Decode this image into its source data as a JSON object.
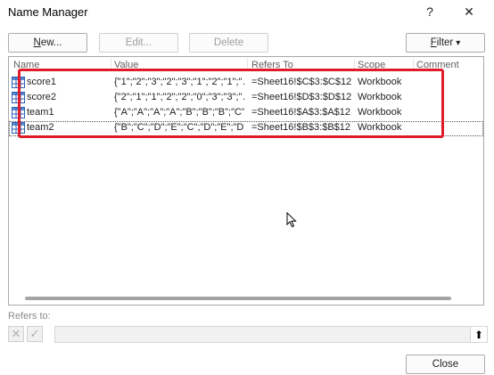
{
  "window": {
    "title": "Name Manager",
    "help_icon": "?",
    "close_icon": "✕"
  },
  "toolbar": {
    "new_label_u": "N",
    "new_label_rest": "ew...",
    "edit_label": "Edit...",
    "delete_label": "Delete",
    "filter_label_u": "F",
    "filter_label_rest": "ilter",
    "filter_caret": "▾"
  },
  "columns": [
    "Name",
    "Value",
    "Refers To",
    "Scope",
    "Comment"
  ],
  "rows": [
    {
      "name": "score1",
      "value": "{\"1\";\"2\";\"3\";\"2\";\"3\";\"1\";\"2\";\"1\";\"…",
      "refers_to": "=Sheet16!$C$3:$C$12",
      "scope": "Workbook",
      "comment": ""
    },
    {
      "name": "score2",
      "value": "{\"2\";\"1\";\"1\";\"2\";\"2\";\"0\";\"3\";\"3\";\"…",
      "refers_to": "=Sheet16!$D$3:$D$12",
      "scope": "Workbook",
      "comment": ""
    },
    {
      "name": "team1",
      "value": "{\"A\";\"A\";\"A\";\"A\";\"B\";\"B\";\"B\";\"C\";…",
      "refers_to": "=Sheet16!$A$3:$A$12",
      "scope": "Workbook",
      "comment": ""
    },
    {
      "name": "team2",
      "value": "{\"B\";\"C\";\"D\";\"E\";\"C\";\"D\";\"E\";\"D\"…",
      "refers_to": "=Sheet16!$B$3:$B$12",
      "scope": "Workbook",
      "comment": ""
    }
  ],
  "refers_to": {
    "label": "Refers to:",
    "cancel_icon": "✕",
    "confirm_icon": "✓",
    "value": "",
    "collapse_icon": "⬆"
  },
  "footer": {
    "close_label": "Close"
  },
  "colors": {
    "highlight": "#e01b2a",
    "disabled_text": "#9e9e9e"
  }
}
